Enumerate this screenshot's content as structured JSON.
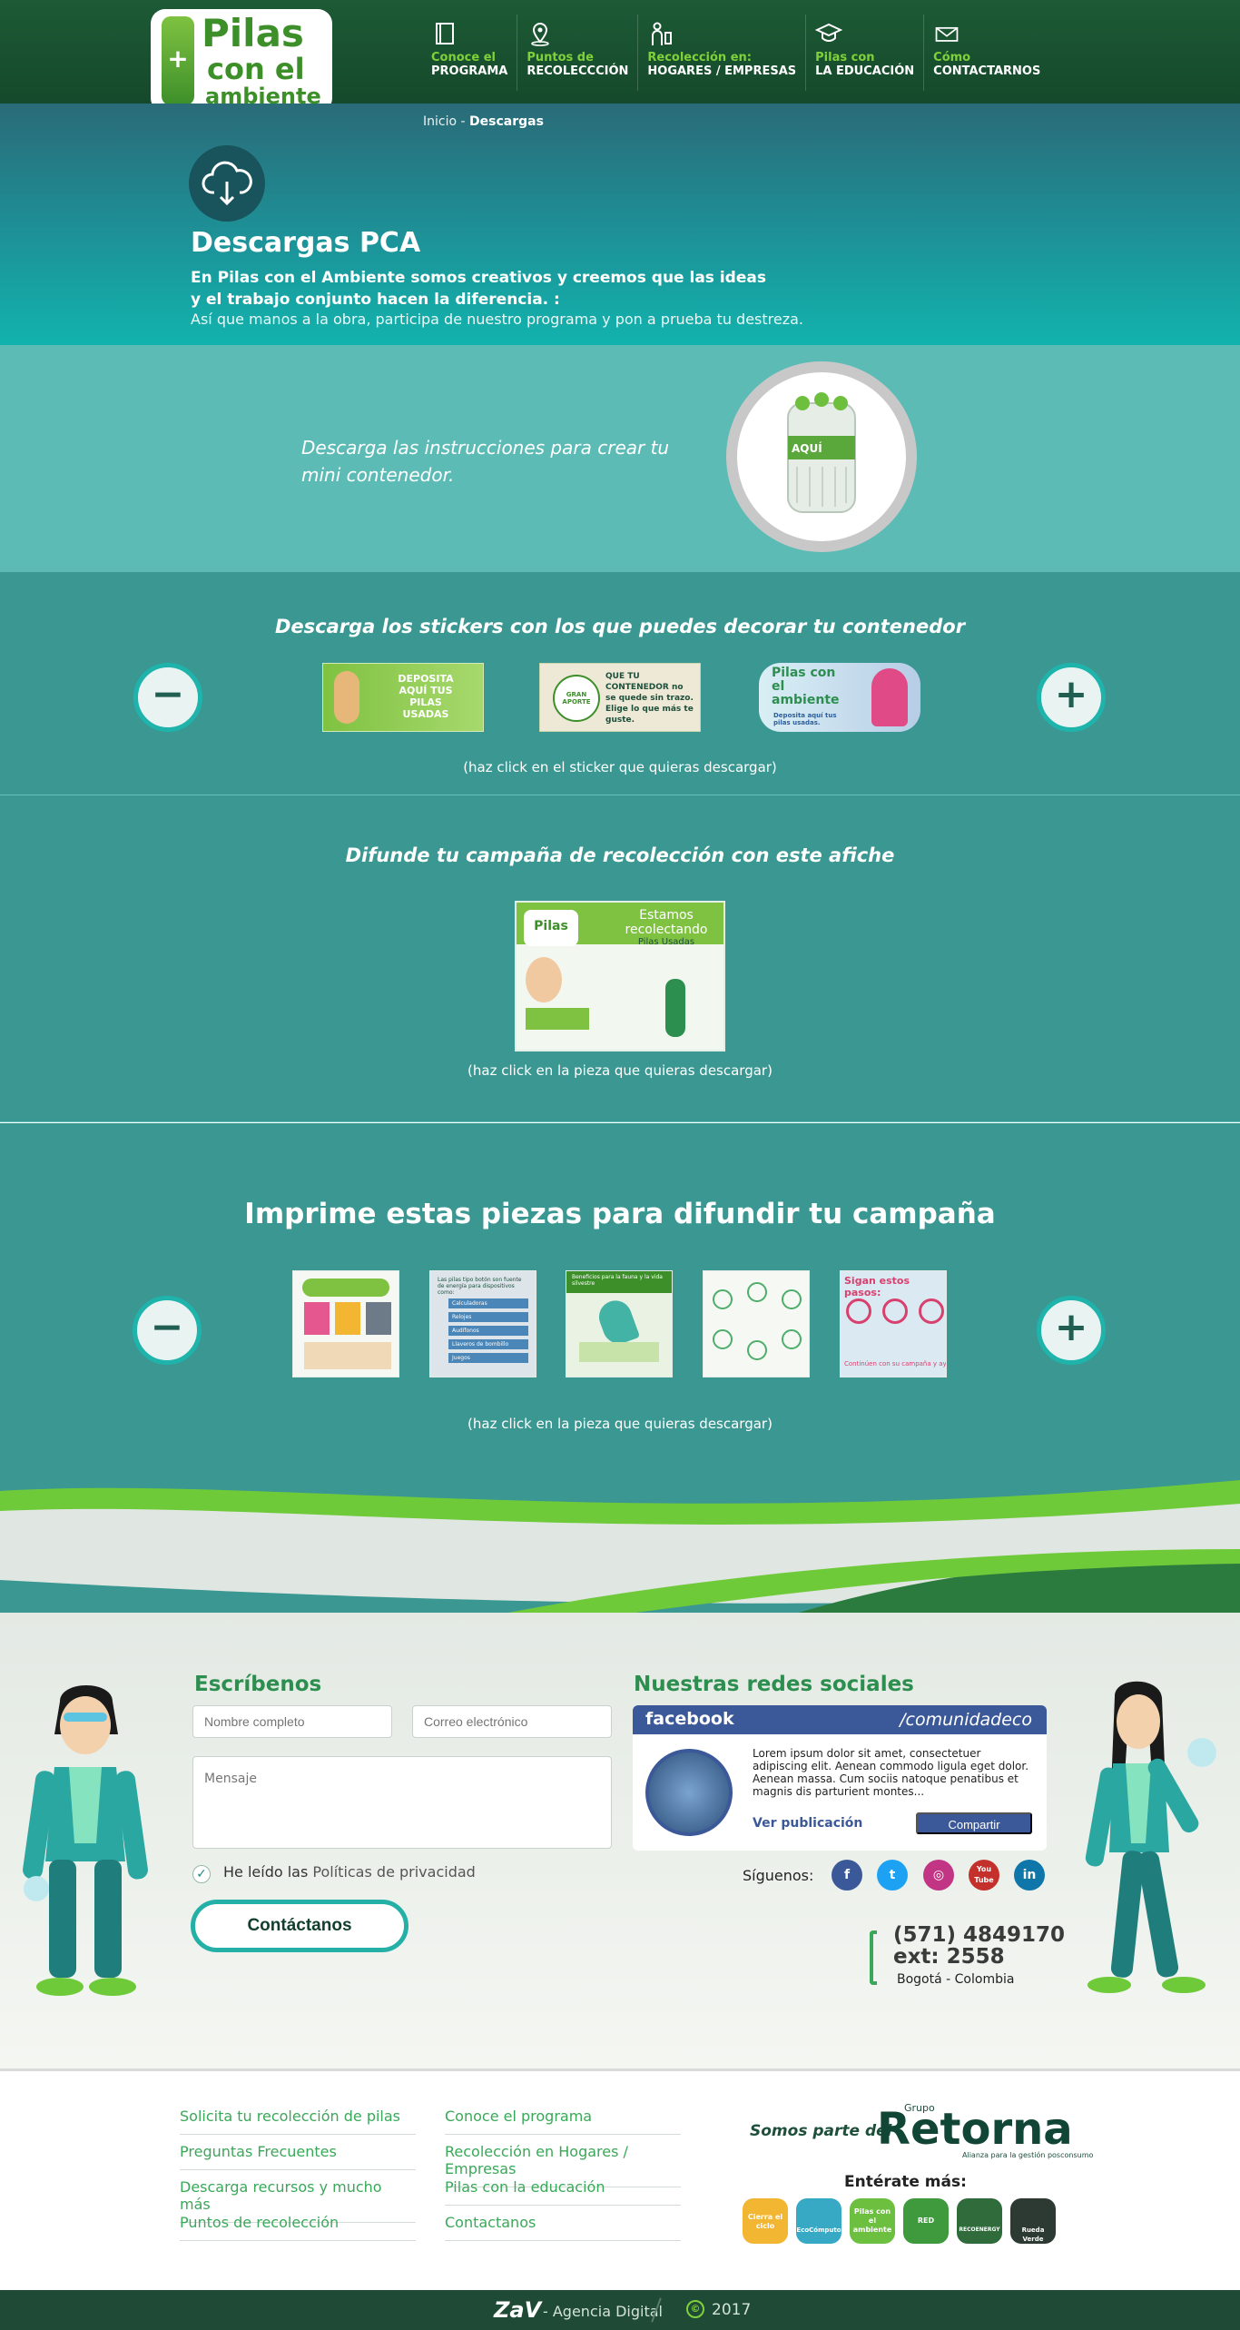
{
  "header": {
    "logo": {
      "line1": "Pilas",
      "line2": "con el",
      "line3": "ambiente",
      "badge": "+"
    },
    "nav": [
      {
        "label_top": "Conoce el",
        "label_bottom": "PROGRAMA",
        "icon": "book-icon"
      },
      {
        "label_top": "Puntos de",
        "label_bottom": "RECOLECCCIÓN",
        "icon": "location-pin-icon"
      },
      {
        "label_top": "Recolección en:",
        "label_bottom": "HOGARES / EMPRESAS",
        "icon": "worker-icon"
      },
      {
        "label_top": "Pilas con",
        "label_bottom": "LA EDUCACIÓN",
        "icon": "graduation-cap-icon"
      },
      {
        "label_top": "Cómo",
        "label_bottom": "CONTACTARNOS",
        "icon": "envelope-icon"
      }
    ]
  },
  "breadcrumb": {
    "home": "Inicio",
    "separator": " - ",
    "current": "Descargas"
  },
  "hero": {
    "icon": "cloud-download-icon",
    "title": "Descargas PCA",
    "bold_line1": "En Pilas con el Ambiente somos creativos y creemos que las ideas",
    "bold_line2": "y el trabajo conjunto hacen la diferencia. :",
    "text": "Así que manos a la obra, participa de nuestro programa y pon a prueba tu destreza."
  },
  "mini_container": {
    "text": "Descarga las instrucciones para crear tu mini contenedor.",
    "image_label": "AQUÍ"
  },
  "stickers": {
    "title": "Descarga los stickers con los que puedes decorar tu contenedor",
    "hint": "(haz click en el sticker que quieras descargar)",
    "prev": "−",
    "next": "+",
    "items": [
      {
        "text": "DEPOSITA AQUÍ TUS PILAS USADAS"
      },
      {
        "text": "QUE TU CONTENEDOR no se quede sin trazo. Elige lo que más te guste.",
        "sub": "GRAN APORTE"
      },
      {
        "text": "Pilas con el ambiente",
        "sub": "Deposita aquí tus pilas usadas."
      }
    ]
  },
  "afiche": {
    "title": "Difunde tu campaña de recolección con este afiche",
    "hint": "(haz click en la pieza que quieras descargar)",
    "poster_title": "Estamos recolectando",
    "poster_sub": "Pilas Usadas"
  },
  "print": {
    "title": "Imprime estas piezas para difundir tu campaña",
    "hint": "(haz click en la pieza que quieras descargar)",
    "prev": "−",
    "next": "+",
    "thumbs": [
      {
        "label": ""
      },
      {
        "label": "Las pilas tipo botón son fuente de energía para dispositivos como:",
        "rows": [
          "Calculadoras",
          "Relojes",
          "Audífonos",
          "Llaveros de bombillo",
          "Juegos"
        ]
      },
      {
        "label": "Beneficios para la fauna y la vida silvestre"
      },
      {
        "label": ""
      },
      {
        "label": "Sigan estos pasos:",
        "foot": "Continúen con su campaña y ay"
      }
    ]
  },
  "contact": {
    "title": "Escríbenos",
    "name_placeholder": "Nombre completo",
    "email_placeholder": "Correo electrónico",
    "message_placeholder": "Mensaje",
    "checkbox_text": "He leído las",
    "checkbox_link": "Políticas de privacidad",
    "submit": "Contáctanos"
  },
  "social": {
    "title": "Nuestras redes sociales",
    "fb_brand": "facebook",
    "fb_handle": "/comunidadeco",
    "fb_text": "Lorem ipsum dolor sit amet, consectetuer adipiscing elit. Aenean commodo ligula eget dolor. Aenean massa. Cum sociis natoque penatibus et magnis dis parturient montes...",
    "fb_link": "Ver publicación",
    "fb_share": "Compartir",
    "follow": "Síguenos:",
    "icons": [
      {
        "name": "facebook-icon",
        "glyph": "f",
        "color": "#3b5998"
      },
      {
        "name": "twitter-icon",
        "glyph": "t",
        "color": "#1da1f2"
      },
      {
        "name": "instagram-icon",
        "glyph": "◎",
        "color": "#c13584"
      },
      {
        "name": "youtube-icon",
        "glyph": "You Tube",
        "color": "#c4302b"
      },
      {
        "name": "linkedin-icon",
        "glyph": "in",
        "color": "#0e76a8"
      }
    ],
    "phone1": "(571) 4849170",
    "phone2": "ext: 2558",
    "city": "Bogotá - Colombia"
  },
  "footer": {
    "col1": [
      "Solicita tu recolección de pilas",
      "Preguntas Frecuentes",
      "Descarga recursos y mucho más",
      "Puntos de recolección"
    ],
    "col2": [
      "Conoce el programa",
      "Recolección en Hogares / Empresas",
      "Pilas con la educación",
      "Contactanos"
    ],
    "somos": "Somos parte del",
    "grupo": "Grupo",
    "retorna": "Retorna",
    "retorna_tag": "Alianza para la gestión posconsumo",
    "enterate": "Entérate más:",
    "brands": [
      {
        "label": "Cierra el ciclo",
        "color": "#f2b632"
      },
      {
        "label": "EcoCómputo",
        "color": "#38a9c4"
      },
      {
        "label": "Pilas con el ambiente",
        "color": "#6cbf3f"
      },
      {
        "label": "RED VERDE",
        "color": "#3f9a3d"
      },
      {
        "label": "RECOENERGY",
        "color": "#2f6b3b"
      },
      {
        "label": "Rueda Verde",
        "color": "#2c3a33"
      }
    ]
  },
  "bottom_bar": {
    "brand": "ZaV",
    "agency": "- Agencia Digital",
    "copyright_symbol": "©",
    "year": "2017"
  },
  "colors": {
    "header_green": "#1d5a35",
    "accent_green": "#7fd13b",
    "teal": "#3a9791",
    "light_teal": "#5dbbb6",
    "facebook_blue": "#3b5998"
  }
}
